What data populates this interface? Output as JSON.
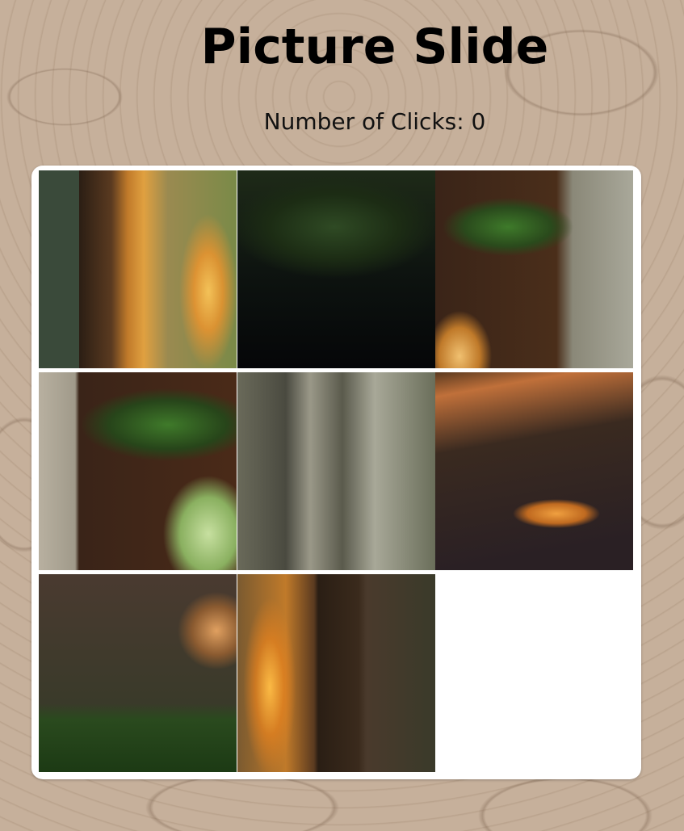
{
  "game": {
    "title": "Picture Slide",
    "clicks_label": "Number of Clicks: 0",
    "clicks_count": 0
  },
  "board": {
    "grid_size": 3,
    "empty_index": 8,
    "tiles": [
      {
        "id": "tile-portal-left-edge",
        "art": "portal left edge with golden glow"
      },
      {
        "id": "tile-dark-foliage",
        "art": "dark foliage"
      },
      {
        "id": "tile-arch-top-right",
        "art": "arch top right with moss"
      },
      {
        "id": "tile-arch-top-left",
        "art": "arch top left with moss"
      },
      {
        "id": "tile-blurred-forest",
        "art": "blurred forest trees"
      },
      {
        "id": "tile-forest-path",
        "art": "forest path with orange light"
      },
      {
        "id": "tile-forest-floor",
        "art": "forest floor with moss"
      },
      {
        "id": "tile-portal-right-edge",
        "art": "portal right edge with golden glow"
      },
      {
        "id": "tile-empty",
        "art": "empty slot"
      }
    ]
  },
  "colors": {
    "background": "#c4ae99",
    "board": "#ffffff",
    "title_text": "#000000"
  }
}
